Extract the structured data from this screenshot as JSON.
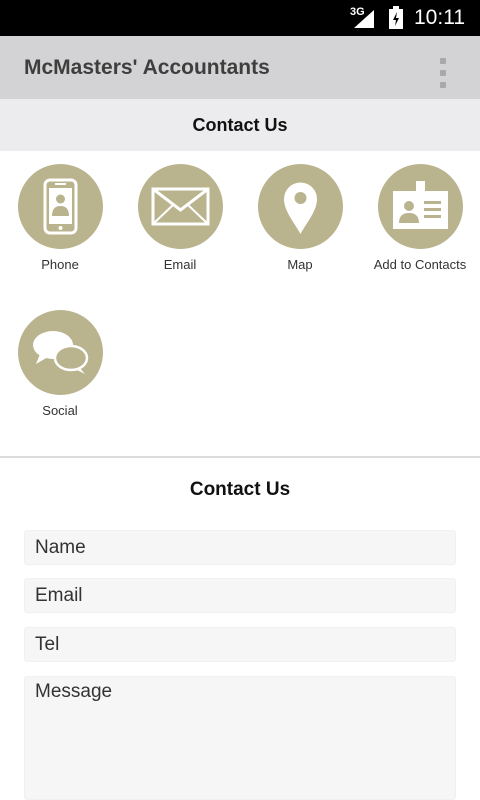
{
  "status_bar": {
    "network": "3G",
    "time": "10:11"
  },
  "app_bar": {
    "title": "McMasters' Accountants",
    "overflow_icon": "more-vert-icon"
  },
  "contact_header": {
    "title": "Contact Us"
  },
  "tiles": [
    {
      "label": "Phone",
      "icon": "phone-icon"
    },
    {
      "label": "Email",
      "icon": "envelope-icon"
    },
    {
      "label": "Map",
      "icon": "map-pin-icon"
    },
    {
      "label": "Add to Contacts",
      "icon": "id-card-icon"
    },
    {
      "label": "Social",
      "icon": "chat-bubbles-icon"
    }
  ],
  "form": {
    "title": "Contact Us",
    "name_placeholder": "Name",
    "email_placeholder": "Email",
    "tel_placeholder": "Tel",
    "message_placeholder": "Message"
  },
  "colors": {
    "icon_circle": "#b9b38e",
    "app_bar": "#d3d3d5",
    "header_band": "#ececee"
  }
}
